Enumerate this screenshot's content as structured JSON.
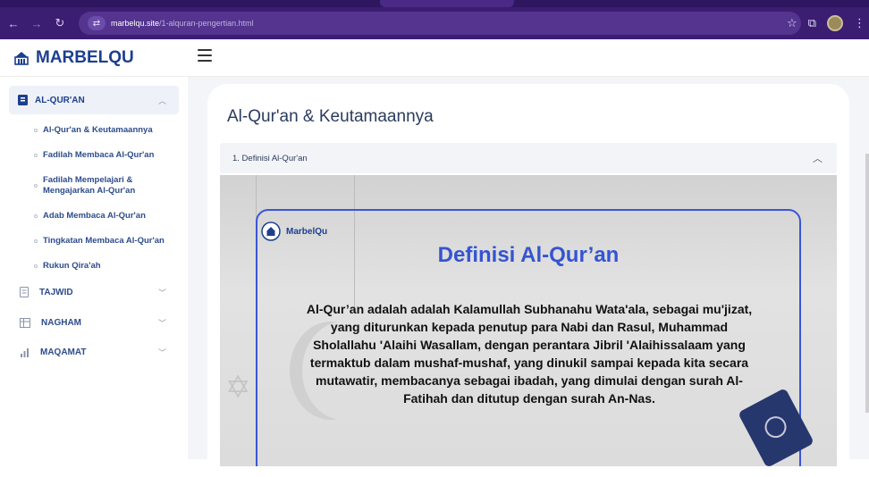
{
  "browser": {
    "url_host": "marbelqu.site",
    "url_path": "/1-alquran-pengertian.html"
  },
  "app": {
    "brand": "MARBELQU"
  },
  "sidebar": {
    "active_section": "AL-QUR'AN",
    "sub_items": [
      "Al-Qur'an & Keutamaannya",
      "Fadilah Membaca Al-Qur'an",
      "Fadilah Mempelajari & Mengajarkan Al-Qur'an",
      "Adab Membaca Al-Qur'an",
      "Tingkatan Membaca Al-Qur'an",
      "Rukun Qira'ah"
    ],
    "sections": [
      "TAJWID",
      "NAGHAM",
      "MAQAMAT"
    ]
  },
  "main": {
    "title": "Al-Qur'an & Keutamaannya",
    "accordion_title": "1. Definisi Al-Qur'an",
    "hero": {
      "brand": "MarbelQu",
      "title": "Definisi Al-Qur’an",
      "text": "Al-Qur’an adalah adalah Kalamullah Subhanahu Wata'ala, sebagai mu'jizat, yang diturunkan kepada penutup para Nabi dan Rasul, Muhammad Sholallahu 'Alaihi Wasallam, dengan perantara Jibril 'Alaihissalaam yang termaktub dalam mushaf-mushaf, yang dinukil sampai kepada kita secara mutawatir, membacanya sebagai ibadah, yang dimulai dengan surah Al-Fatihah dan ditutup dengan surah An-Nas."
    }
  },
  "colors": {
    "browser_bg": "#3b1d72",
    "brand_blue": "#1c3f8e",
    "hero_title": "#3554d1",
    "frame": "#3b55d6"
  }
}
